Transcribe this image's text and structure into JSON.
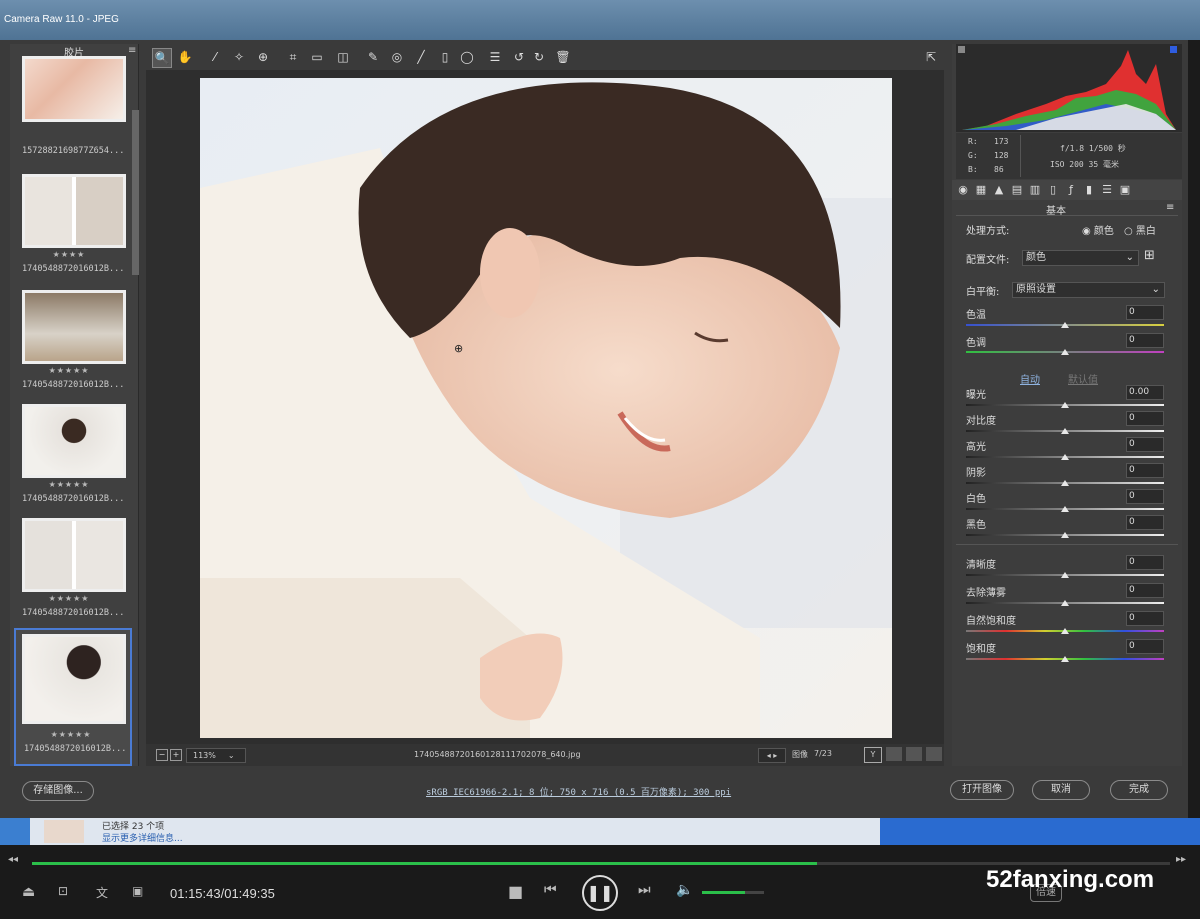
{
  "window": {
    "title": "Camera Raw 11.0 - JPEG"
  },
  "filmstrip": {
    "header": "胶片",
    "items": [
      {
        "name": "1572882169877Z654...",
        "stars": ""
      },
      {
        "name": "1740548872016012B...",
        "stars": "★★★★"
      },
      {
        "name": "1740548872016012B...",
        "stars": "★★★★★"
      },
      {
        "name": "1740548872016012B...",
        "stars": "★★★★★"
      },
      {
        "name": "1740548872016012B...",
        "stars": "★★★★★"
      },
      {
        "name": "1740548872016012B...",
        "stars": "★★★★★"
      }
    ]
  },
  "preview": {
    "zoom": "113%",
    "filename": "17405488720160128111702078_640.jpg",
    "image_label": "图像",
    "image_counter": "7/23"
  },
  "histogram": {
    "r": "173",
    "g": "128",
    "b": "86",
    "aperture_shutter": "f/1.8  1/500 秒",
    "iso_focal": "ISO 200  35 毫米"
  },
  "panel": {
    "title": "基本",
    "treatment_label": "处理方式:",
    "treatment_color": "颜色",
    "treatment_bw": "黑白",
    "profile_label": "配置文件:",
    "profile_value": "颜色",
    "wb_label": "白平衡:",
    "wb_value": "原照设置",
    "auto": "自动",
    "default": "默认值",
    "sliders": [
      {
        "label": "色温",
        "value": "0"
      },
      {
        "label": "色调",
        "value": "0"
      },
      {
        "label": "曝光",
        "value": "0.00"
      },
      {
        "label": "对比度",
        "value": "0"
      },
      {
        "label": "高光",
        "value": "0"
      },
      {
        "label": "阴影",
        "value": "0"
      },
      {
        "label": "白色",
        "value": "0"
      },
      {
        "label": "黑色",
        "value": "0"
      },
      {
        "label": "清晰度",
        "value": "0"
      },
      {
        "label": "去除薄雾",
        "value": "0"
      },
      {
        "label": "自然饱和度",
        "value": "0"
      },
      {
        "label": "饱和度",
        "value": "0"
      }
    ]
  },
  "footer": {
    "save": "存储图像...",
    "workflow": "sRGB IEC61966-2.1; 8 位; 750 x 716 (0.5 百万像素); 300 ppi",
    "open": "打开图像",
    "cancel": "取消",
    "done": "完成"
  },
  "taskbar": {
    "line1": "已选择 23 个项",
    "line2": "显示更多详细信息..."
  },
  "player": {
    "time": "01:15:43/01:49:35",
    "progress_fraction": 0.69,
    "volume_fraction": 0.7,
    "watermark": "52fanxing.com",
    "speed": "倍速"
  }
}
